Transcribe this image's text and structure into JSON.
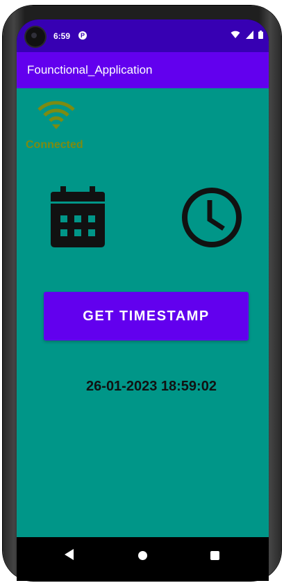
{
  "status_bar": {
    "time": "6:59",
    "notification_icon": "media-notification-icon",
    "icons": [
      "wifi-icon",
      "signal-icon",
      "battery-icon"
    ],
    "color": "#3700b3"
  },
  "app_bar": {
    "title": "Founctional_Application",
    "color": "#6200ee"
  },
  "content": {
    "background": "#009688",
    "network": {
      "icon": "wifi-icon",
      "status": "Connected",
      "color": "#7c8b12"
    },
    "date_icon": "calendar-icon",
    "time_icon": "clock-icon",
    "button": {
      "label": "GET TIMESTAMP",
      "color": "#6200ee"
    },
    "timestamp": "26-01-2023 18:59:02"
  },
  "nav_bar": {
    "icons": [
      "back-icon",
      "home-icon",
      "recents-icon"
    ]
  }
}
